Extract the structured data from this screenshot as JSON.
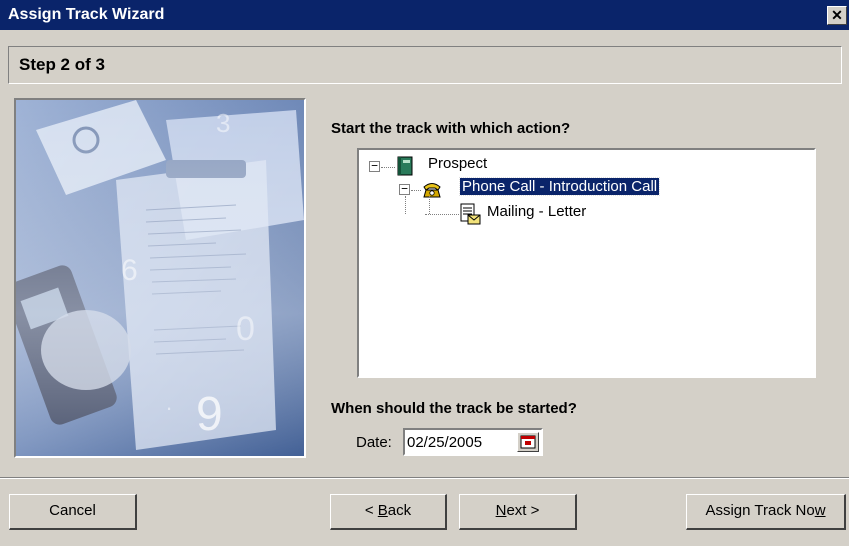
{
  "window": {
    "title": "Assign Track Wizard",
    "close_symbol": "✕"
  },
  "step": {
    "label": "Step 2 of 3"
  },
  "question_action": "Start the track with which action?",
  "tree": {
    "nodes": [
      {
        "label": "Prospect",
        "icon": "book-icon",
        "expander": "−"
      },
      {
        "label": "Phone Call - Introduction Call",
        "icon": "phone-icon",
        "expander": "−",
        "selected": true
      },
      {
        "label": "Mailing - Letter",
        "icon": "letter-icon"
      }
    ]
  },
  "question_start": "When should the track be started?",
  "date": {
    "label": "Date:",
    "value": "02/25/2005"
  },
  "buttons": {
    "cancel": "Cancel",
    "back_prefix": "< ",
    "back_accel": "B",
    "back_rest": "ack",
    "next_accel": "N",
    "next_rest": "ext >",
    "assign_main": "Assign Track No",
    "assign_accel": "w"
  },
  "colors": {
    "titlebar": "#0a246a",
    "face": "#d4d0c8",
    "selection": "#0a246a"
  }
}
